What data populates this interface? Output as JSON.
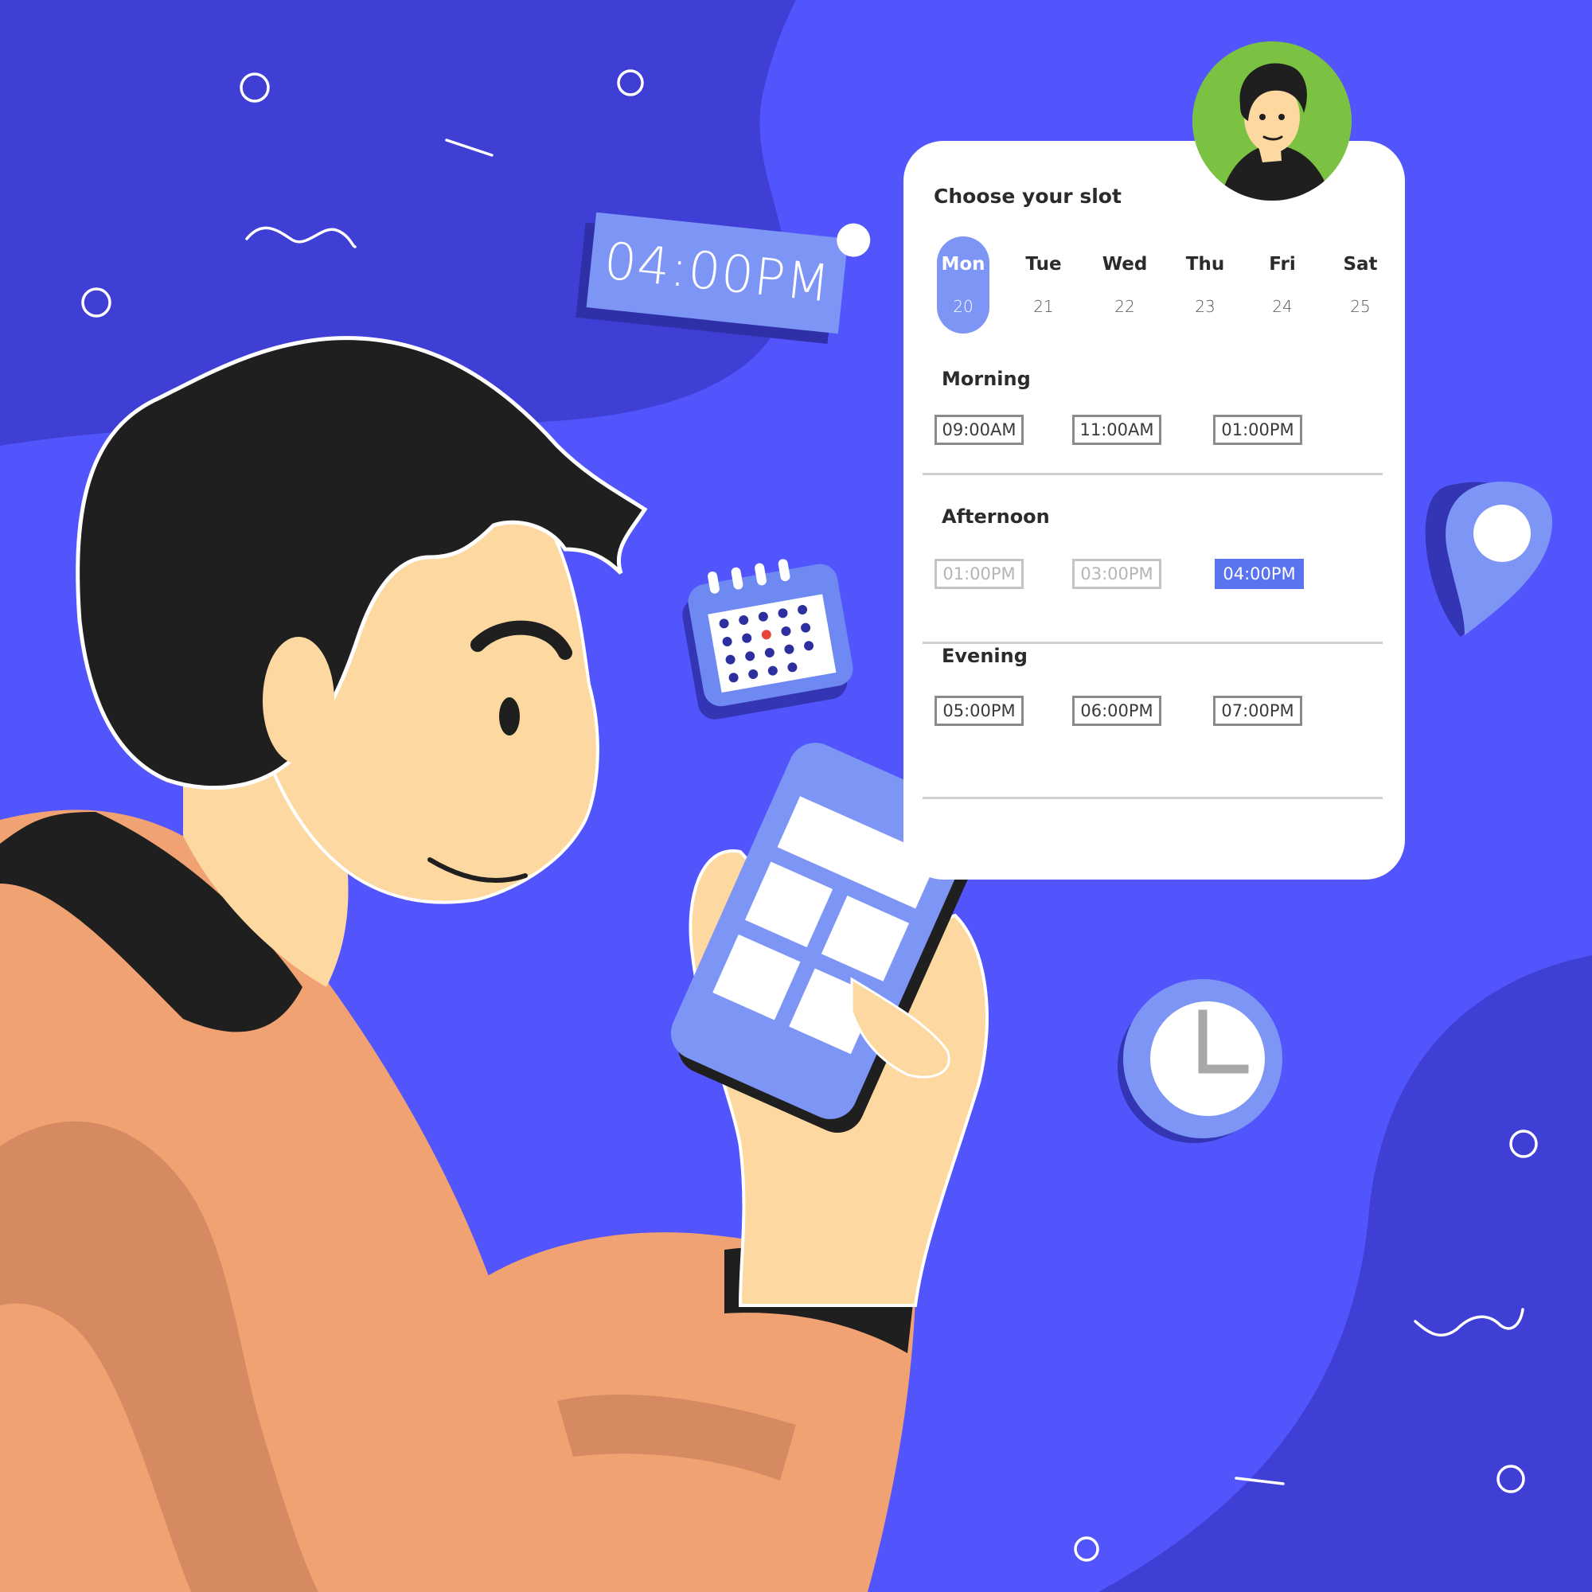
{
  "colors": {
    "background": "#3f3fd6",
    "background_light": "#5355fc",
    "accent": "#7d95f5",
    "selected_slot": "#5a73ee",
    "avatar_bg": "#7cc242",
    "jacket": "#f1a272",
    "skin": "#fdd8a0",
    "hair": "#1f1f1f"
  },
  "time_tag": {
    "label": "04:00PM"
  },
  "card": {
    "title": "Choose your slot",
    "days": [
      {
        "name": "Mon",
        "date": "20",
        "selected": true
      },
      {
        "name": "Tue",
        "date": "21"
      },
      {
        "name": "Wed",
        "date": "22"
      },
      {
        "name": "Thu",
        "date": "23"
      },
      {
        "name": "Fri",
        "date": "24"
      },
      {
        "name": "Sat",
        "date": "25"
      }
    ],
    "sections": [
      {
        "label": "Morning",
        "slots": [
          "09:00AM",
          "11:00AM",
          "01:00PM"
        ]
      },
      {
        "label": "Afternoon",
        "slots": [
          "01:00PM",
          "03:00PM",
          "04:00PM"
        ],
        "disabled": [
          "01:00PM",
          "03:00PM"
        ],
        "selected": "04:00PM"
      },
      {
        "label": "Evening",
        "slots": [
          "05:00PM",
          "06:00PM",
          "07:00PM"
        ]
      }
    ]
  },
  "icons": [
    "avatar-icon",
    "calendar-icon",
    "clock-icon",
    "location-pin-icon",
    "smartphone-icon"
  ]
}
